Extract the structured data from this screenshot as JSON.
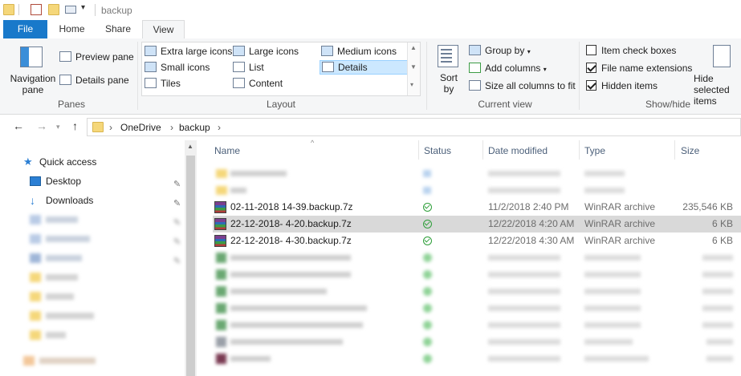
{
  "window": {
    "title": "backup"
  },
  "tabs": {
    "file": "File",
    "home": "Home",
    "share": "Share",
    "view": "View"
  },
  "ribbon": {
    "panes": {
      "navigation_pane": "Navigation pane",
      "preview_pane": "Preview pane",
      "details_pane": "Details pane",
      "label": "Panes"
    },
    "layout": {
      "items": [
        "Extra large icons",
        "Large icons",
        "Medium icons",
        "Small icons",
        "List",
        "Details",
        "Tiles",
        "Content"
      ],
      "selected": "Details",
      "label": "Layout"
    },
    "current_view": {
      "sort_by": "Sort by",
      "group_by": "Group by",
      "add_columns": "Add columns",
      "size_all_columns": "Size all columns to fit",
      "label": "Current view"
    },
    "show_hide": {
      "item_check_boxes": {
        "label": "Item check boxes",
        "checked": false
      },
      "file_name_extensions": {
        "label": "File name extensions",
        "checked": true
      },
      "hidden_items": {
        "label": "Hidden items",
        "checked": true
      },
      "hide_selected": "Hide selected items",
      "label": "Show/hide"
    }
  },
  "address": {
    "crumbs": [
      "OneDrive",
      "backup"
    ]
  },
  "nav": {
    "quick_access": "Quick access",
    "desktop": "Desktop",
    "downloads": "Downloads"
  },
  "columns": {
    "name": "Name",
    "status": "Status",
    "date_modified": "Date modified",
    "type": "Type",
    "size": "Size"
  },
  "files": [
    {
      "name": "02-11-2018 14-39.backup.7z",
      "date": "11/2/2018 2:40 PM",
      "type": "WinRAR archive",
      "size": "235,546 KB",
      "selected": false
    },
    {
      "name": "22-12-2018- 4-20.backup.7z",
      "date": "12/22/2018 4:20 AM",
      "type": "WinRAR archive",
      "size": "6 KB",
      "selected": true
    },
    {
      "name": "22-12-2018- 4-30.backup.7z",
      "date": "12/22/2018 4:30 AM",
      "type": "WinRAR archive",
      "size": "6 KB",
      "selected": false
    }
  ],
  "colors": {
    "accent": "#1979ca",
    "selected_row": "#d9d9d9",
    "status_ok": "#2e9f3a"
  }
}
